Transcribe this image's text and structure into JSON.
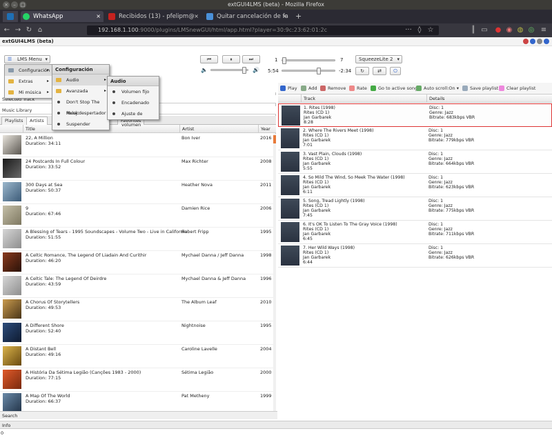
{
  "window": {
    "title": "extGUI4LMS (beta) - Mozilla Firefox"
  },
  "tabs": [
    {
      "label": "WhatsApp",
      "color": "#25d366"
    },
    {
      "label": "Recibidos (13) - pfelipm@",
      "color": "#c5221f"
    },
    {
      "label": "Quitar cancelación de fa",
      "color": "#4a90d9"
    }
  ],
  "url": {
    "host": "192.168.1.100",
    "rest": ":9000/plugins/LMSnewGUI/html/app.html?player=30:9c:23:62:01:2c"
  },
  "app": {
    "title": "extGUI4LMS (beta)"
  },
  "controls": {
    "menu_button": "LMS Menu",
    "volume_min": "1",
    "volume_max": "7",
    "player": "SqueezeLite 2",
    "elapsed": "5:54",
    "remaining": "-2:34",
    "volume_fraction": 0.92,
    "progress_fraction": 0.7
  },
  "left": {
    "header1": "Selected Track",
    "header2": "Music Library",
    "tabs": [
      "Playlists",
      "Artists",
      "Favorites"
    ],
    "columns": [
      "Title",
      "Artist",
      "Year"
    ],
    "albums": [
      {
        "title": "22, A Million",
        "duration": "Duration: 34:11",
        "artist": "Bon Iver",
        "year": "2016",
        "c1": "#e8e4dc",
        "c2": "#5a5650"
      },
      {
        "title": "24 Postcards In Full Colour",
        "duration": "Duration: 33:52",
        "artist": "Max Richter",
        "year": "2008",
        "c1": "#1a1a1a",
        "c2": "#6a6a6a"
      },
      {
        "title": "300 Days at Sea",
        "duration": "Duration: 50:37",
        "artist": "Heather Nova",
        "year": "2011",
        "c1": "#9bb7cc",
        "c2": "#3c5b78"
      },
      {
        "title": "9",
        "duration": "Duration: 67:46",
        "artist": "Damien Rice",
        "year": "2006",
        "c1": "#c4bfa8",
        "c2": "#7d7760"
      },
      {
        "title": "A Blessing of Tears - 1995 Soundscapes - Volume Two - Live in California",
        "duration": "Duration: 51:55",
        "artist": "Robert Fripp",
        "year": "1995",
        "c1": "#d6d6d6",
        "c2": "#8e8e8e"
      },
      {
        "title": "A Celtic Romance, The Legend Of Liadain And Curithir",
        "duration": "Duration: 46:20",
        "artist": "Mychael Danna / Jeff Danna",
        "year": "1998",
        "c1": "#8a3a1e",
        "c2": "#2a1208"
      },
      {
        "title": "A Celtic Tale: The Legend Of Deirdre",
        "duration": "Duration: 43:59",
        "artist": "Mychael Danna & Jeff Danna",
        "year": "1996",
        "c1": "#d6d6d6",
        "c2": "#8e8e8e"
      },
      {
        "title": "A Chorus Of Storytellers",
        "duration": "Duration: 49:53",
        "artist": "The Album Leaf",
        "year": "2010",
        "c1": "#c99a4e",
        "c2": "#4a3618"
      },
      {
        "title": "A Different Shore",
        "duration": "Duration: 52:40",
        "artist": "Nightnoise",
        "year": "1995",
        "c1": "#2d4d7c",
        "c2": "#0e1a30"
      },
      {
        "title": "A Distant Bell",
        "duration": "Duration: 49:16",
        "artist": "Caroline Lavelle",
        "year": "2004",
        "c1": "#d9b24a",
        "c2": "#6a4a10"
      },
      {
        "title": "A História Da Sétima Legião (Canções 1983 - 2000)",
        "duration": "Duration: 77:15",
        "artist": "Sétima Legião",
        "year": "2000",
        "c1": "#e05a2a",
        "c2": "#7a2a0e"
      },
      {
        "title": "A Map Of The World",
        "duration": "Duration: 66:37",
        "artist": "Pat Metheny",
        "year": "1999",
        "c1": "#6a8aa8",
        "c2": "#223348"
      }
    ],
    "search_label": "Search"
  },
  "right": {
    "toolbar": [
      "Play",
      "Add",
      "Remove",
      "Rate",
      "Go to active song",
      "Auto scroll:On",
      "Save playlist",
      "Clear playlist"
    ],
    "columns": [
      "Track",
      "Details"
    ],
    "tracks": [
      {
        "title": "1. Rites (1998)",
        "album": "Rites (CD 1)",
        "artist": "Jan Garbarek",
        "time": "8:28",
        "disc": "Disc: 1",
        "genre": "Genre: Jazz",
        "bitrate": "Bitrate: 683kbps VBR"
      },
      {
        "title": "2. Where The Rivers Meet (1998)",
        "album": "Rites (CD 1)",
        "artist": "Jan Garbarek",
        "time": "7:01",
        "disc": "Disc: 1",
        "genre": "Genre: Jazz",
        "bitrate": "Bitrate: 779kbps VBR"
      },
      {
        "title": "3. Vast Plain, Clouds (1998)",
        "album": "Rites (CD 1)",
        "artist": "Jan Garbarek",
        "time": "5:55",
        "disc": "Disc: 1",
        "genre": "Genre: Jazz",
        "bitrate": "Bitrate: 664kbps VBR"
      },
      {
        "title": "4. So Mild The Wind, So Meek The Water (1998)",
        "album": "Rites (CD 1)",
        "artist": "Jan Garbarek",
        "time": "6:11",
        "disc": "Disc: 1",
        "genre": "Genre: Jazz",
        "bitrate": "Bitrate: 623kbps VBR"
      },
      {
        "title": "5. Song, Tread Lightly (1998)",
        "album": "Rites (CD 1)",
        "artist": "Jan Garbarek",
        "time": "7:45",
        "disc": "Disc: 1",
        "genre": "Genre: Jazz",
        "bitrate": "Bitrate: 775kbps VBR"
      },
      {
        "title": "6. It's OK To Listen To The Gray Voice (1998)",
        "album": "Rites (CD 1)",
        "artist": "Jan Garbarek",
        "time": "6:45",
        "disc": "Disc: 1",
        "genre": "Genre: Jazz",
        "bitrate": "Bitrate: 711kbps VBR"
      },
      {
        "title": "7. Her Wild Ways (1998)",
        "album": "Rites (CD 1)",
        "artist": "Jan Garbarek",
        "time": "6:44",
        "disc": "Disc: 1",
        "genre": "Genre: Jazz",
        "bitrate": "Bitrate: 626kbps VBR"
      }
    ]
  },
  "menus": {
    "main": [
      {
        "label": "Configuración",
        "icon": "wrench-icon"
      },
      {
        "label": "Extras",
        "icon": "folder-icon"
      },
      {
        "label": "Mi música",
        "icon": "folder-icon"
      }
    ],
    "config_title": "Configuración",
    "config": [
      "Audio",
      "Avanzada",
      "Don't Stop The Music",
      "Reloj despertador",
      "Suspender"
    ],
    "audio_title": "Audio",
    "audio": [
      "Volumen fijo",
      "Encadenado",
      "Ajuste de volumen"
    ]
  },
  "info": {
    "label": "Info",
    "status": "0"
  }
}
